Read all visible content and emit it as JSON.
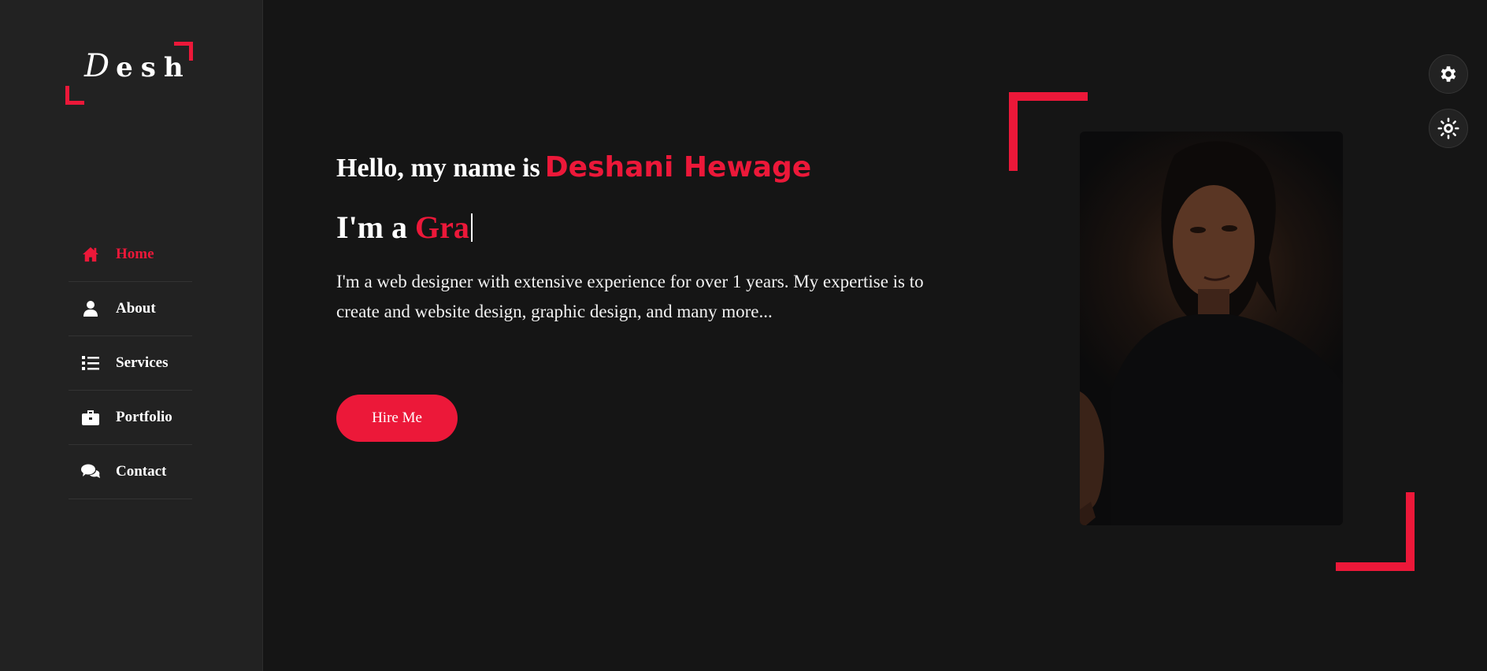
{
  "logo": {
    "first_letter": "D",
    "rest": "esh"
  },
  "nav": {
    "items": [
      {
        "label": "Home",
        "icon": "home-icon",
        "active": true
      },
      {
        "label": "About",
        "icon": "user-icon",
        "active": false
      },
      {
        "label": "Services",
        "icon": "list-icon",
        "active": false
      },
      {
        "label": "Portfolio",
        "icon": "briefcase-icon",
        "active": false
      },
      {
        "label": "Contact",
        "icon": "comments-icon",
        "active": false
      }
    ]
  },
  "hero": {
    "greeting": "Hello, my name is",
    "name": "Deshani Hewage",
    "role_prefix": "I'm a",
    "role_typed": "Gra",
    "intro": "I'm a web designer with extensive experience for over 1 years. My expertise is to create and website design, graphic design, and many more...",
    "hire_button": "Hire Me"
  },
  "style_switcher": {
    "settings_icon": "gear-icon",
    "theme_icon": "sun-icon"
  },
  "colors": {
    "accent": "#ec1839",
    "background": "#151515",
    "sidebar": "#222222"
  }
}
